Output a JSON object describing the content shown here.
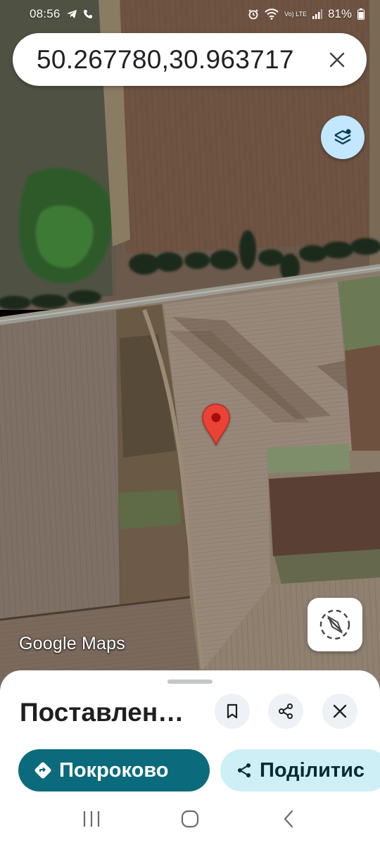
{
  "status_bar": {
    "time": "08:56",
    "battery_percent": "81%",
    "network": "Vo) LTE"
  },
  "search": {
    "query": "50.267780,30.963717"
  },
  "map": {
    "type": "satellite",
    "pin_color": "#ea4335",
    "watermark": "Google Maps"
  },
  "sheet": {
    "title": "Поставлен…",
    "actions": [
      {
        "label": "Покроково",
        "icon": "directions-icon"
      },
      {
        "label": "Поділитис",
        "icon": "share-icon"
      }
    ]
  },
  "colors": {
    "accent": "#0b6b7c",
    "chip_light": "#cfeff6",
    "layers_button": "#c2e7ff"
  },
  "icons": {
    "layers": "layers-icon",
    "compass": "compass-icon",
    "save": "bookmark-icon",
    "share": "share-icon",
    "close": "close-icon",
    "nav_recents": "recents-icon",
    "nav_home": "home-icon",
    "nav_back": "back-icon"
  }
}
